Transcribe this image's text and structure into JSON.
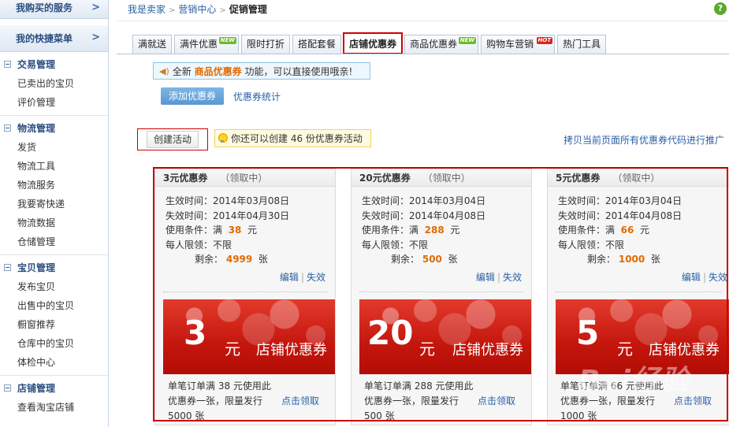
{
  "sidebar": {
    "purchased": "我购买的服务",
    "shortcut": "我的快捷菜单",
    "sections": [
      {
        "title": "交易管理",
        "items": [
          "已卖出的宝贝",
          "评价管理"
        ]
      },
      {
        "title": "物流管理",
        "items": [
          "发货",
          "物流工具",
          "物流服务",
          "我要寄快递",
          "物流数据",
          "仓储管理"
        ]
      },
      {
        "title": "宝贝管理",
        "items": [
          "发布宝贝",
          "出售中的宝贝",
          "橱窗推荐",
          "仓库中的宝贝",
          "体检中心"
        ]
      },
      {
        "title": "店铺管理",
        "items": [
          "查看淘宝店铺"
        ]
      }
    ]
  },
  "breadcrumb": {
    "seller": "我是卖家",
    "center": "营销中心",
    "current": "促销管理"
  },
  "help": "?",
  "tabs": [
    {
      "label": "满就送",
      "badge": ""
    },
    {
      "label": "满件优惠",
      "badge": "NEW"
    },
    {
      "label": "限时打折",
      "badge": ""
    },
    {
      "label": "搭配套餐",
      "badge": ""
    },
    {
      "label": "店铺优惠券",
      "badge": "",
      "active": true
    },
    {
      "label": "商品优惠券",
      "badge": "NEW"
    },
    {
      "label": "购物车营销",
      "badge": "HOT"
    },
    {
      "label": "热门工具",
      "badge": ""
    }
  ],
  "notice": {
    "pre": "全新",
    "highlight": "商品优惠券",
    "post": "功能，可以直接使用哦亲!"
  },
  "actions": {
    "add_coupon": "添加优惠券",
    "coupon_stats": "优惠券统计",
    "create": "创建活动",
    "tip": "你还可以创建 46 份优惠券活动",
    "copy_codes": "拷贝当前页面所有优惠券代码进行推广"
  },
  "coupon_labels": {
    "start": "生效时间：",
    "end": "失效时间：",
    "cond": "使用条件：",
    "cond_pre": "满",
    "cond_unit": "元",
    "limit": "每人限领：",
    "remain": "剩余：",
    "remain_unit": "张",
    "edit": "编辑",
    "disable": "失效",
    "yuan": "元",
    "banner_label": "店铺优惠券",
    "get": "点击领取"
  },
  "coupons": [
    {
      "name": "3元优惠券",
      "status": "（领取中）",
      "start": "2014年03月08日",
      "end": "2014年04月30日",
      "threshold": "38",
      "limit": "不限",
      "remaining": "4999",
      "amount": "3",
      "desc": "单笔订单满 38 元使用此优惠券一张，限量发行 5000 张"
    },
    {
      "name": "20元优惠券",
      "status": "（领取中）",
      "start": "2014年03月04日",
      "end": "2014年04月08日",
      "threshold": "288",
      "limit": "不限",
      "remaining": "500",
      "amount": "20",
      "desc": "单笔订单满 288 元使用此优惠券一张，限量发行 500 张"
    },
    {
      "name": "5元优惠券",
      "status": "（领取中）",
      "start": "2014年03月04日",
      "end": "2014年04月08日",
      "threshold": "66",
      "limit": "不限",
      "remaining": "1000",
      "amount": "5",
      "desc": "单笔订单满 66 元使用此优惠券一张，限量发行 1000 张"
    }
  ],
  "watermark": "Bai经验"
}
